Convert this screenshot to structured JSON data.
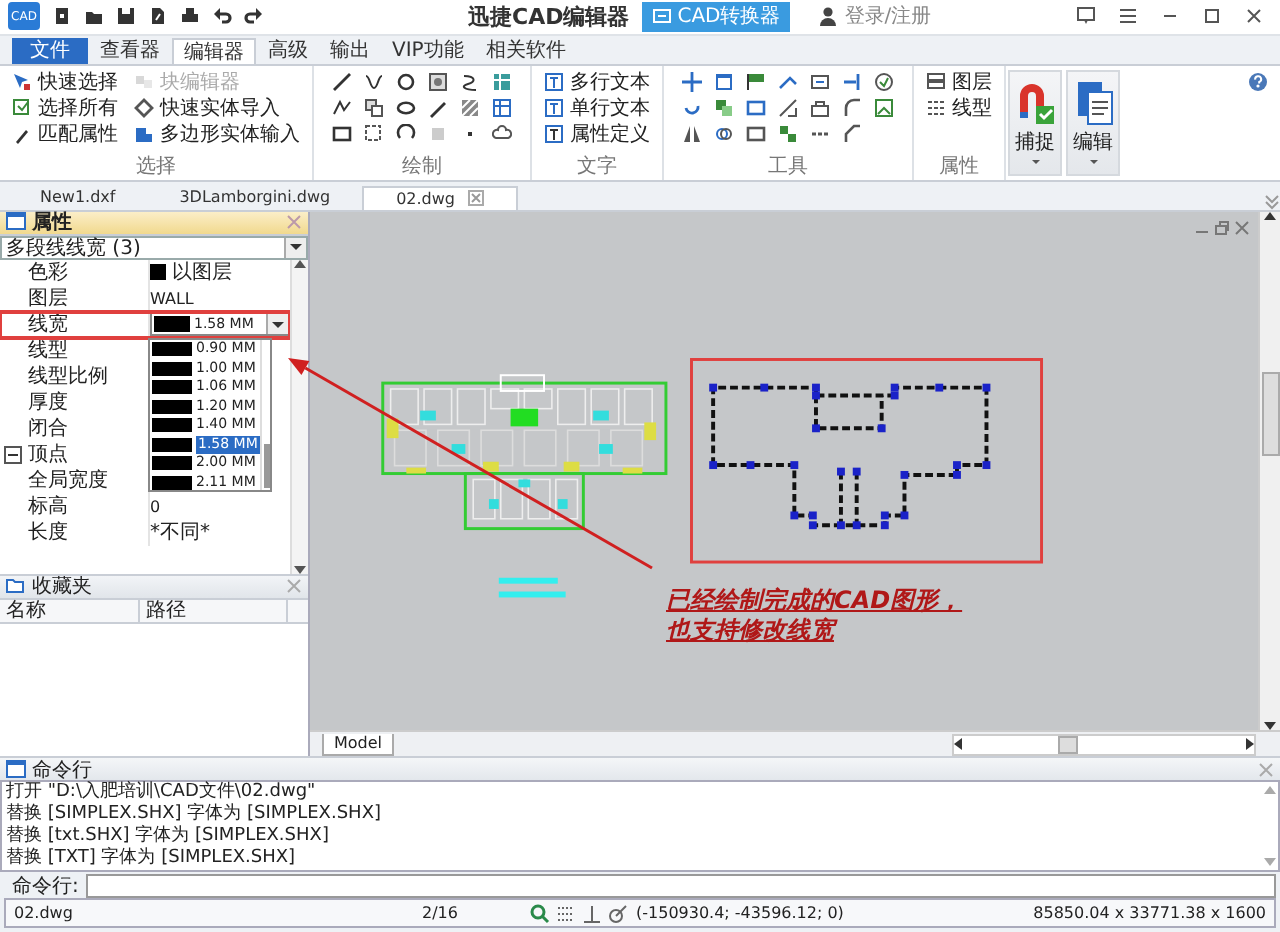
{
  "app": {
    "logo": "CAD",
    "title": "迅捷CAD编辑器",
    "converter_button": "CAD转换器",
    "login": "登录/注册"
  },
  "ribbon_tabs": [
    {
      "label": "文件",
      "kind": "file",
      "selected": false
    },
    {
      "label": "查看器",
      "kind": "tab",
      "selected": false
    },
    {
      "label": "编辑器",
      "kind": "tab",
      "selected": true
    },
    {
      "label": "高级",
      "kind": "tab",
      "selected": false
    },
    {
      "label": "输出",
      "kind": "tab",
      "selected": false
    },
    {
      "label": "VIP功能",
      "kind": "tab",
      "selected": false
    },
    {
      "label": "相关软件",
      "kind": "tab",
      "selected": false
    }
  ],
  "ribbon_groups": [
    {
      "label": "选择",
      "kind": "list",
      "items": [
        {
          "label": "快速选择",
          "disabled": false
        },
        {
          "label": "选择所有",
          "disabled": false
        },
        {
          "label": "匹配属性",
          "disabled": false
        },
        {
          "label": "块编辑器",
          "disabled": true
        },
        {
          "label": "快速实体导入",
          "disabled": false
        },
        {
          "label": "多边形实体输入",
          "disabled": false
        }
      ]
    },
    {
      "label": "绘制",
      "kind": "icons"
    },
    {
      "label": "文字",
      "kind": "list",
      "items": [
        {
          "label": "多行文本",
          "disabled": false
        },
        {
          "label": "单行文本",
          "disabled": false
        },
        {
          "label": "属性定义",
          "disabled": false
        }
      ]
    },
    {
      "label": "工具",
      "kind": "icons"
    },
    {
      "label": "属性",
      "kind": "list",
      "items": [
        {
          "label": "图层",
          "disabled": false
        },
        {
          "label": "线型",
          "disabled": false
        }
      ]
    },
    {
      "label": "捕捉",
      "kind": "big"
    },
    {
      "label": "编辑",
      "kind": "big"
    }
  ],
  "doc_tabs": [
    {
      "label": "New1.dxf",
      "selected": false
    },
    {
      "label": "3DLamborgini.dwg",
      "selected": false
    },
    {
      "label": "02.dwg",
      "selected": true
    }
  ],
  "properties": {
    "title": "属性",
    "selector": "多段线线宽 (3)",
    "rows": [
      {
        "kind": "color",
        "name": "色彩",
        "value": "以图层"
      },
      {
        "kind": "text",
        "name": "图层",
        "value": "WALL"
      },
      {
        "kind": "lineweight",
        "name": "线宽",
        "value": "1.58 MM",
        "highlighted": true
      },
      {
        "kind": "text",
        "name": "线型"
      },
      {
        "kind": "text",
        "name": "线型比例"
      },
      {
        "kind": "text",
        "name": "厚度"
      },
      {
        "kind": "text",
        "name": "闭合"
      },
      {
        "kind": "category",
        "name": "顶点",
        "expanded": true
      },
      {
        "kind": "text",
        "name": "全局宽度"
      },
      {
        "kind": "text",
        "name": "标高",
        "value": "0"
      },
      {
        "kind": "text",
        "name": "长度",
        "value": "*不同*"
      }
    ],
    "lineweight_options": [
      {
        "label": "0.90 MM",
        "selected": false
      },
      {
        "label": "1.00 MM",
        "selected": false
      },
      {
        "label": "1.06 MM",
        "selected": false
      },
      {
        "label": "1.20 MM",
        "selected": false
      },
      {
        "label": "1.40 MM",
        "selected": false
      },
      {
        "label": "1.58 MM",
        "selected": true
      },
      {
        "label": "2.00 MM",
        "selected": false
      },
      {
        "label": "2.11 MM",
        "selected": false
      }
    ]
  },
  "favorites": {
    "title": "收藏夹",
    "columns": [
      "名称",
      "路径"
    ]
  },
  "canvas": {
    "layout_tab": "Model",
    "annotation": [
      "已经绘制完成的CAD图形，",
      "也支持修改线宽"
    ]
  },
  "command": {
    "title": "命令行",
    "log": [
      "打开 \"D:\\入肥培训\\CAD文件\\02.dwg\"",
      "替换 [SIMPLEX.SHX] 字体为 [SIMPLEX.SHX]",
      "替换 [txt.SHX] 字体为 [SIMPLEX.SHX]",
      "替换 [TXT] 字体为 [SIMPLEX.SHX]"
    ],
    "prompt": "命令行:"
  },
  "status_bar": {
    "file": "02.dwg",
    "page": "2/16",
    "coords": "(-150930.4; -43596.12; 0)",
    "extents": "85850.04 x 33771.38 x 1600"
  }
}
